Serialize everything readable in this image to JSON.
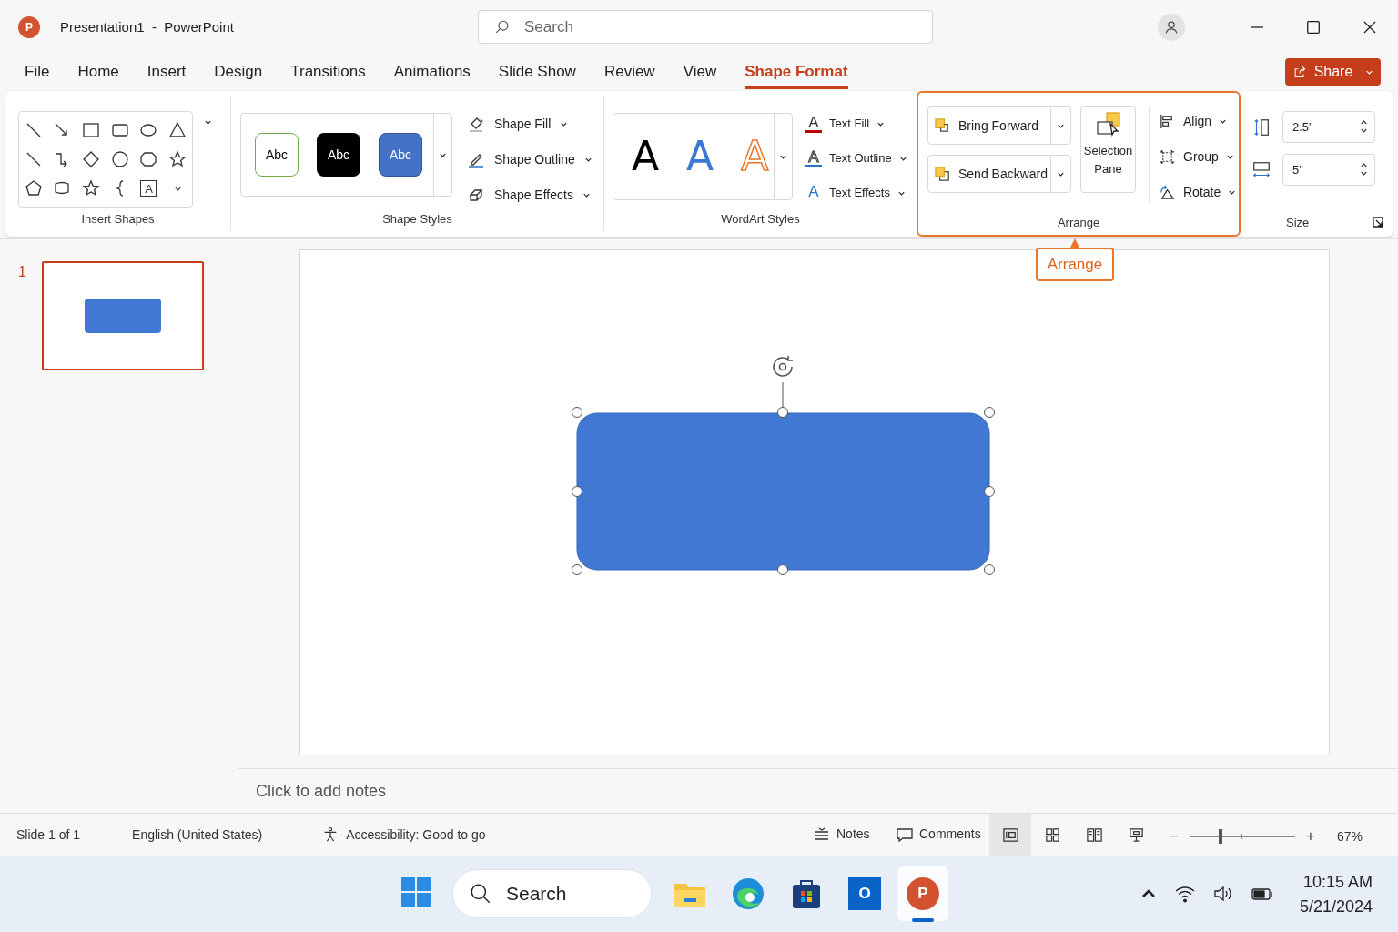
{
  "app": {
    "logo_glyph": "P",
    "title": "Presentation1  -  PowerPoint"
  },
  "title_search": {
    "placeholder": "Search"
  },
  "menu_tabs": [
    {
      "label": "File",
      "selected": false
    },
    {
      "label": "Home",
      "selected": false
    },
    {
      "label": "Insert",
      "selected": false
    },
    {
      "label": "Design",
      "selected": false
    },
    {
      "label": "Transitions",
      "selected": false
    },
    {
      "label": "Animations",
      "selected": false
    },
    {
      "label": "Slide Show",
      "selected": false
    },
    {
      "label": "Review",
      "selected": false
    },
    {
      "label": "View",
      "selected": false
    },
    {
      "label": "Shape Format",
      "selected": true
    }
  ],
  "share_button": {
    "label": "Share"
  },
  "ribbon": {
    "insert_shapes": {
      "label": "Insert Shapes",
      "textbox_glyph": "A"
    },
    "shape_styles": {
      "label": "Shape Styles",
      "presets": [
        {
          "label": "Abc",
          "kind": "outline"
        },
        {
          "label": "Abc",
          "kind": "dark"
        },
        {
          "label": "Abc",
          "kind": "blue"
        }
      ],
      "commands": [
        {
          "label": "Shape Fill",
          "kind": "fill"
        },
        {
          "label": "Shape Outline",
          "kind": "outline"
        },
        {
          "label": "Shape Effects",
          "kind": "effects"
        }
      ]
    },
    "wordart_styles": {
      "label": "WordArt Styles",
      "presets": [
        {
          "letter": "A",
          "kind": "black"
        },
        {
          "letter": "A",
          "kind": "blue"
        },
        {
          "letter": "A",
          "kind": "outline"
        }
      ],
      "commands": [
        {
          "label": "Text Fill",
          "glyph": "A",
          "kind": "fill"
        },
        {
          "label": "Text Outline",
          "glyph": "A",
          "kind": "outline"
        },
        {
          "label": "Text Effects",
          "glyph": "A",
          "kind": "effects"
        }
      ]
    },
    "arrange": {
      "label": "Arrange",
      "highlighted": true,
      "split_buttons": [
        {
          "label": "Bring Forward",
          "kind": "forward"
        },
        {
          "label": "Send Backward",
          "kind": "backward"
        }
      ],
      "selection_pane": {
        "label": "Selection Pane"
      },
      "commands": [
        {
          "label": "Align",
          "kind": "align"
        },
        {
          "label": "Group",
          "kind": "group"
        },
        {
          "label": "Rotate",
          "kind": "rotate"
        }
      ]
    },
    "size": {
      "label": "Size",
      "height": "2.5\"",
      "width": "5\""
    }
  },
  "callout": {
    "label": "Arrange"
  },
  "slides": [
    {
      "number": "1",
      "selected": true
    }
  ],
  "notes": {
    "placeholder": "Click to add notes"
  },
  "status_bar": {
    "slide": "Slide 1 of 1",
    "language": "English (United States)",
    "accessibility": "Accessibility: Good to go",
    "notes": "Notes",
    "comments": "Comments",
    "views": [
      {
        "kind": "normal",
        "selected": true
      },
      {
        "kind": "sorter",
        "selected": false
      },
      {
        "kind": "reading",
        "selected": false
      },
      {
        "kind": "presenter",
        "selected": false
      }
    ],
    "zoom": {
      "minus": "−",
      "plus": "+",
      "level": 0.29,
      "reading": "67%"
    }
  },
  "taskbar": {
    "search": {
      "placeholder": "Search"
    },
    "apps": [
      {
        "kind": "files",
        "selected": false
      },
      {
        "kind": "edge",
        "selected": false
      },
      {
        "kind": "store",
        "selected": false
      },
      {
        "kind": "outlook",
        "glyph": "O",
        "selected": false
      },
      {
        "kind": "powerpoint",
        "glyph": "P",
        "selected": true
      }
    ],
    "clock": {
      "time": "10:15 AM",
      "date": "5/21/2024"
    }
  }
}
